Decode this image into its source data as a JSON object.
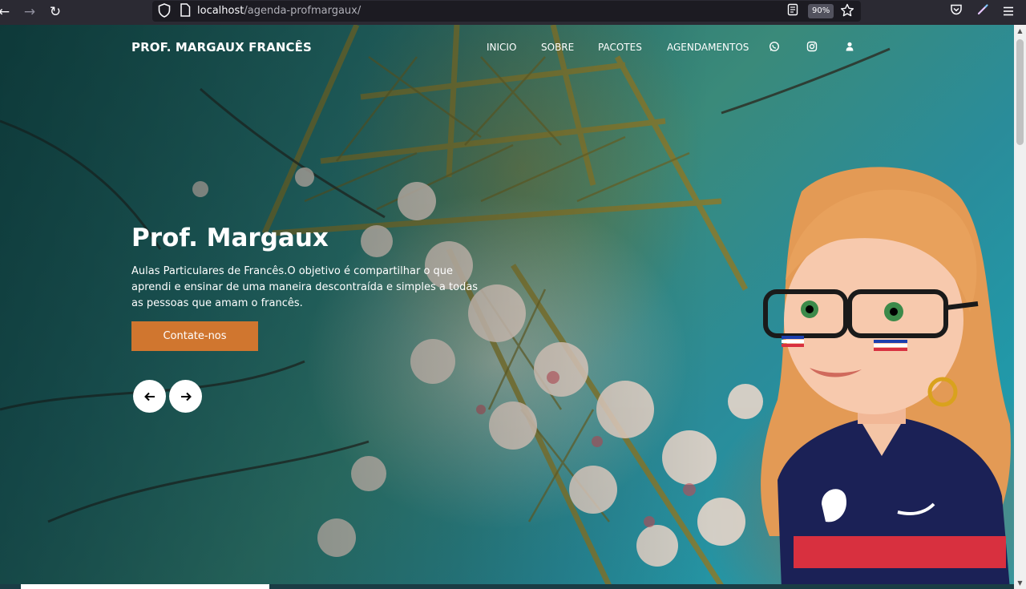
{
  "browser": {
    "url_host": "localhost",
    "url_path": "/agenda-profmargaux/",
    "zoom": "90%",
    "icons": [
      "back-arrow-icon",
      "forward-arrow-icon",
      "reload-icon",
      "shield-icon",
      "page-icon",
      "reader-view-icon",
      "bookmark-star-icon",
      "pocket-icon",
      "pen-icon",
      "menu-icon"
    ]
  },
  "site": {
    "brand": "PROF. MARGAUX FRANCÊS",
    "nav": [
      "INICIO",
      "SOBRE",
      "PACOTES",
      "AGENDAMENTOS"
    ],
    "nav_icons": [
      "whatsapp-icon",
      "instagram-icon",
      "user-icon"
    ]
  },
  "hero": {
    "title": "Prof. Margaux",
    "text": "Aulas Particulares de Francês.O objetivo é compartilhar o que aprendi e ensinar de uma maneira descontraída e simples a todas as pessoas que amam o francês.",
    "cta_label": "Contate-nos",
    "prev_icon": "arrow-left-icon",
    "next_icon": "arrow-right-icon"
  },
  "colors": {
    "accent": "#d0762f",
    "toolbar_bg": "#2b2a33",
    "urlbar_bg": "#1c1b22"
  }
}
